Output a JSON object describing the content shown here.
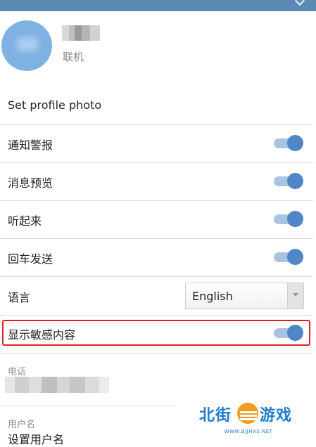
{
  "profile": {
    "status": "联机"
  },
  "settings": {
    "set_photo": "Set profile photo",
    "notifications": {
      "label": "通知警报",
      "on": true
    },
    "message_preview": {
      "label": "消息预览",
      "on": true
    },
    "sounds": {
      "label": "听起来",
      "on": true
    },
    "enter_to_send": {
      "label": "回车发送",
      "on": true
    },
    "language": {
      "label": "语言",
      "value": "English"
    },
    "sensitive_content": {
      "label": "显示敏感内容",
      "on": true
    }
  },
  "account": {
    "phone_label": "电话",
    "username_label": "用户名",
    "username_value": "设置用户名"
  },
  "watermark": {
    "brand_left": "北街",
    "brand_right": "游戏",
    "url": "WWW.BJJHXS.NET"
  },
  "colors": {
    "accent": "#4f86c6",
    "highlight_border": "#e02020"
  }
}
